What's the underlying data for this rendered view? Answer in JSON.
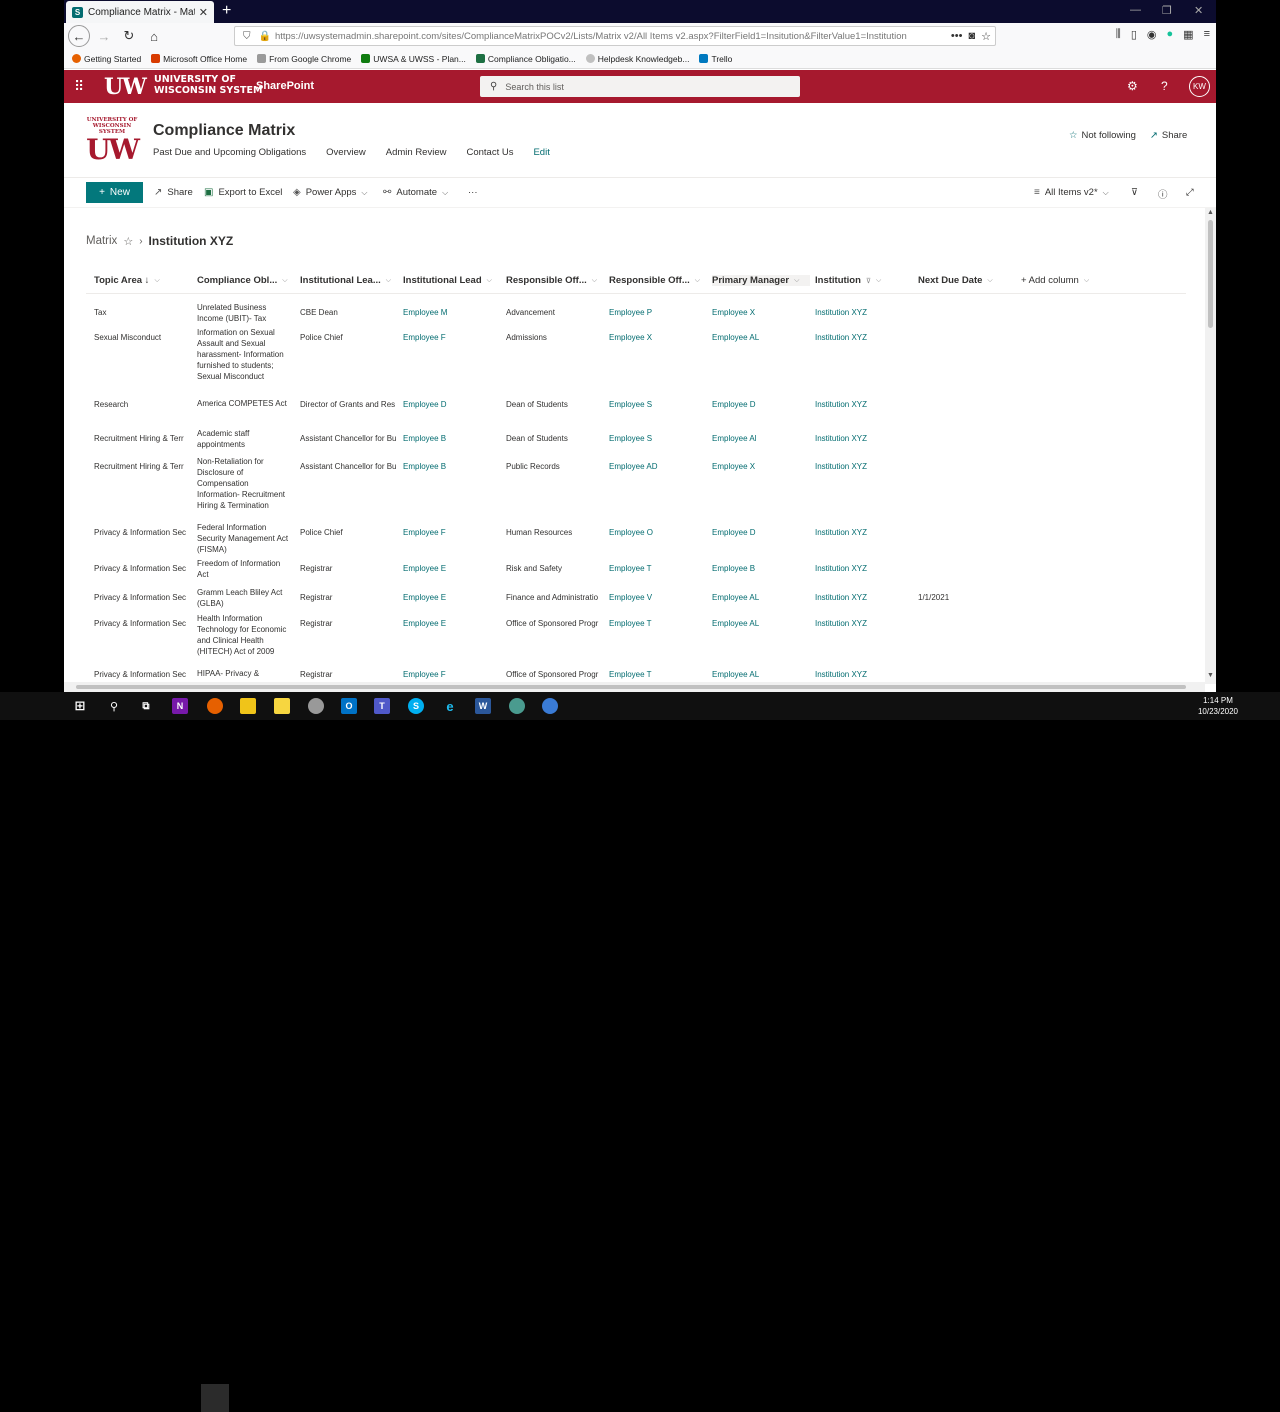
{
  "browser": {
    "tab_title": "Compliance Matrix - Matrix - A",
    "url": "https://uwsystemadmin.sharepoint.com/sites/ComplianceMatrixPOCv2/Lists/Matrix v2/All Items v2.aspx?FilterField1=Insitution&FilterValue1=Institution",
    "bookmarks": [
      "Getting Started",
      "Microsoft Office Home",
      "From Google Chrome",
      "UWSA & UWSS - Plan...",
      "Compliance Obligatio...",
      "Helpdesk Knowledgeb...",
      "Trello"
    ]
  },
  "suite": {
    "logo_mark": "UW",
    "logo_line1": "UNIVERSITY OF",
    "logo_line2": "WISCONSIN SYSTEM",
    "app_name": "SharePoint",
    "search_placeholder": "Search this list",
    "user_initials": "KW"
  },
  "site": {
    "logo_top1": "UNIVERSITY OF",
    "logo_top2": "WISCONSIN SYSTEM",
    "logo_mark": "UW",
    "title": "Compliance Matrix",
    "nav": [
      "Past Due and Upcoming Obligations",
      "Overview",
      "Admin Review",
      "Contact Us"
    ],
    "nav_edit": "Edit",
    "follow_label": "Not following",
    "share_label": "Share"
  },
  "commands": {
    "new_label": "New",
    "share_label": "Share",
    "export_label": "Export to Excel",
    "powerapps_label": "Power Apps",
    "automate_label": "Automate",
    "more_label": "···",
    "view_label": "All Items v2*"
  },
  "breadcrumb": {
    "root": "Matrix",
    "current": "Institution XYZ"
  },
  "columns": [
    "Topic Area ↓",
    "Compliance Obl...",
    "Institutional Lea...",
    "Institutional Lead",
    "Responsible Off...",
    "Responsible Off...",
    "Primary Manager",
    "Institution",
    "Next Due Date",
    "+ Add column"
  ],
  "rows": [
    {
      "topic": "Tax",
      "obligation": "Unrelated Business Income (UBIT)- Tax",
      "lead_title": "CBE Dean",
      "lead": "Employee M",
      "office": "Advancement",
      "officer": "Employee P",
      "manager": "Employee X",
      "institution": "Institution XYZ",
      "due": ""
    },
    {
      "topic": "Sexual Misconduct",
      "obligation": "Information on Sexual Assault and Sexual harassment- Information furnished to students; Sexual Misconduct",
      "lead_title": "Police Chief",
      "lead": "Employee F",
      "office": "Admissions",
      "officer": "Employee X",
      "manager": "Employee AL",
      "institution": "Institution XYZ",
      "due": ""
    },
    {
      "topic": "Research",
      "obligation": "America COMPETES Act",
      "lead_title": "Director of Grants and Res",
      "lead": "Employee D",
      "office": "Dean of Students",
      "officer": "Employee S",
      "manager": "Employee D",
      "institution": "Institution XYZ",
      "due": ""
    },
    {
      "topic": "Recruitment Hiring & Terr",
      "obligation": "Academic staff appointments",
      "lead_title": "Assistant Chancellor for Bu",
      "lead": "Employee B",
      "office": "Dean of Students",
      "officer": "Employee S",
      "manager": "Employee Al",
      "institution": "Institution XYZ",
      "due": ""
    },
    {
      "topic": "Recruitment Hiring & Terr",
      "obligation": "Non-Retaliation for Disclosure of Compensation Information- Recruitment Hiring & Termination",
      "lead_title": "Assistant Chancellor for Bu",
      "lead": "Employee B",
      "office": "Public Records",
      "officer": "Employee AD",
      "manager": "Employee X",
      "institution": "Institution XYZ",
      "due": ""
    },
    {
      "topic": "Privacy & Information Sec",
      "obligation": "Federal Information Security Management Act (FISMA)",
      "lead_title": "Police Chief",
      "lead": "Employee F",
      "office": "Human Resources",
      "officer": "Employee O",
      "manager": "Employee D",
      "institution": "Institution XYZ",
      "due": ""
    },
    {
      "topic": "Privacy & Information Sec",
      "obligation": "Freedom of Information Act",
      "lead_title": "Registrar",
      "lead": "Employee E",
      "office": "Risk and Safety",
      "officer": "Employee T",
      "manager": "Employee B",
      "institution": "Institution XYZ",
      "due": ""
    },
    {
      "topic": "Privacy & Information Sec",
      "obligation": "Gramm Leach Bliley Act (GLBA)",
      "lead_title": "Registrar",
      "lead": "Employee E",
      "office": "Finance and Administratio",
      "officer": "Employee V",
      "manager": "Employee AL",
      "institution": "Institution XYZ",
      "due": "1/1/2021"
    },
    {
      "topic": "Privacy & Information Sec",
      "obligation": "Health Information Technology for Economic and Clinical Health (HITECH) Act of 2009",
      "lead_title": "Registrar",
      "lead": "Employee E",
      "office": "Office of Sponsored Progr",
      "officer": "Employee T",
      "manager": "Employee AL",
      "institution": "Institution XYZ",
      "due": ""
    },
    {
      "topic": "Privacy & Information Sec",
      "obligation": "HIPAA- Privacy &",
      "lead_title": "Registrar",
      "lead": "Employee F",
      "office": "Office of Sponsored Progr",
      "officer": "Employee T",
      "manager": "Employee AL",
      "institution": "Institution XYZ",
      "due": ""
    }
  ],
  "taskbar": {
    "time": "1:14 PM",
    "date": "10/23/2020"
  }
}
